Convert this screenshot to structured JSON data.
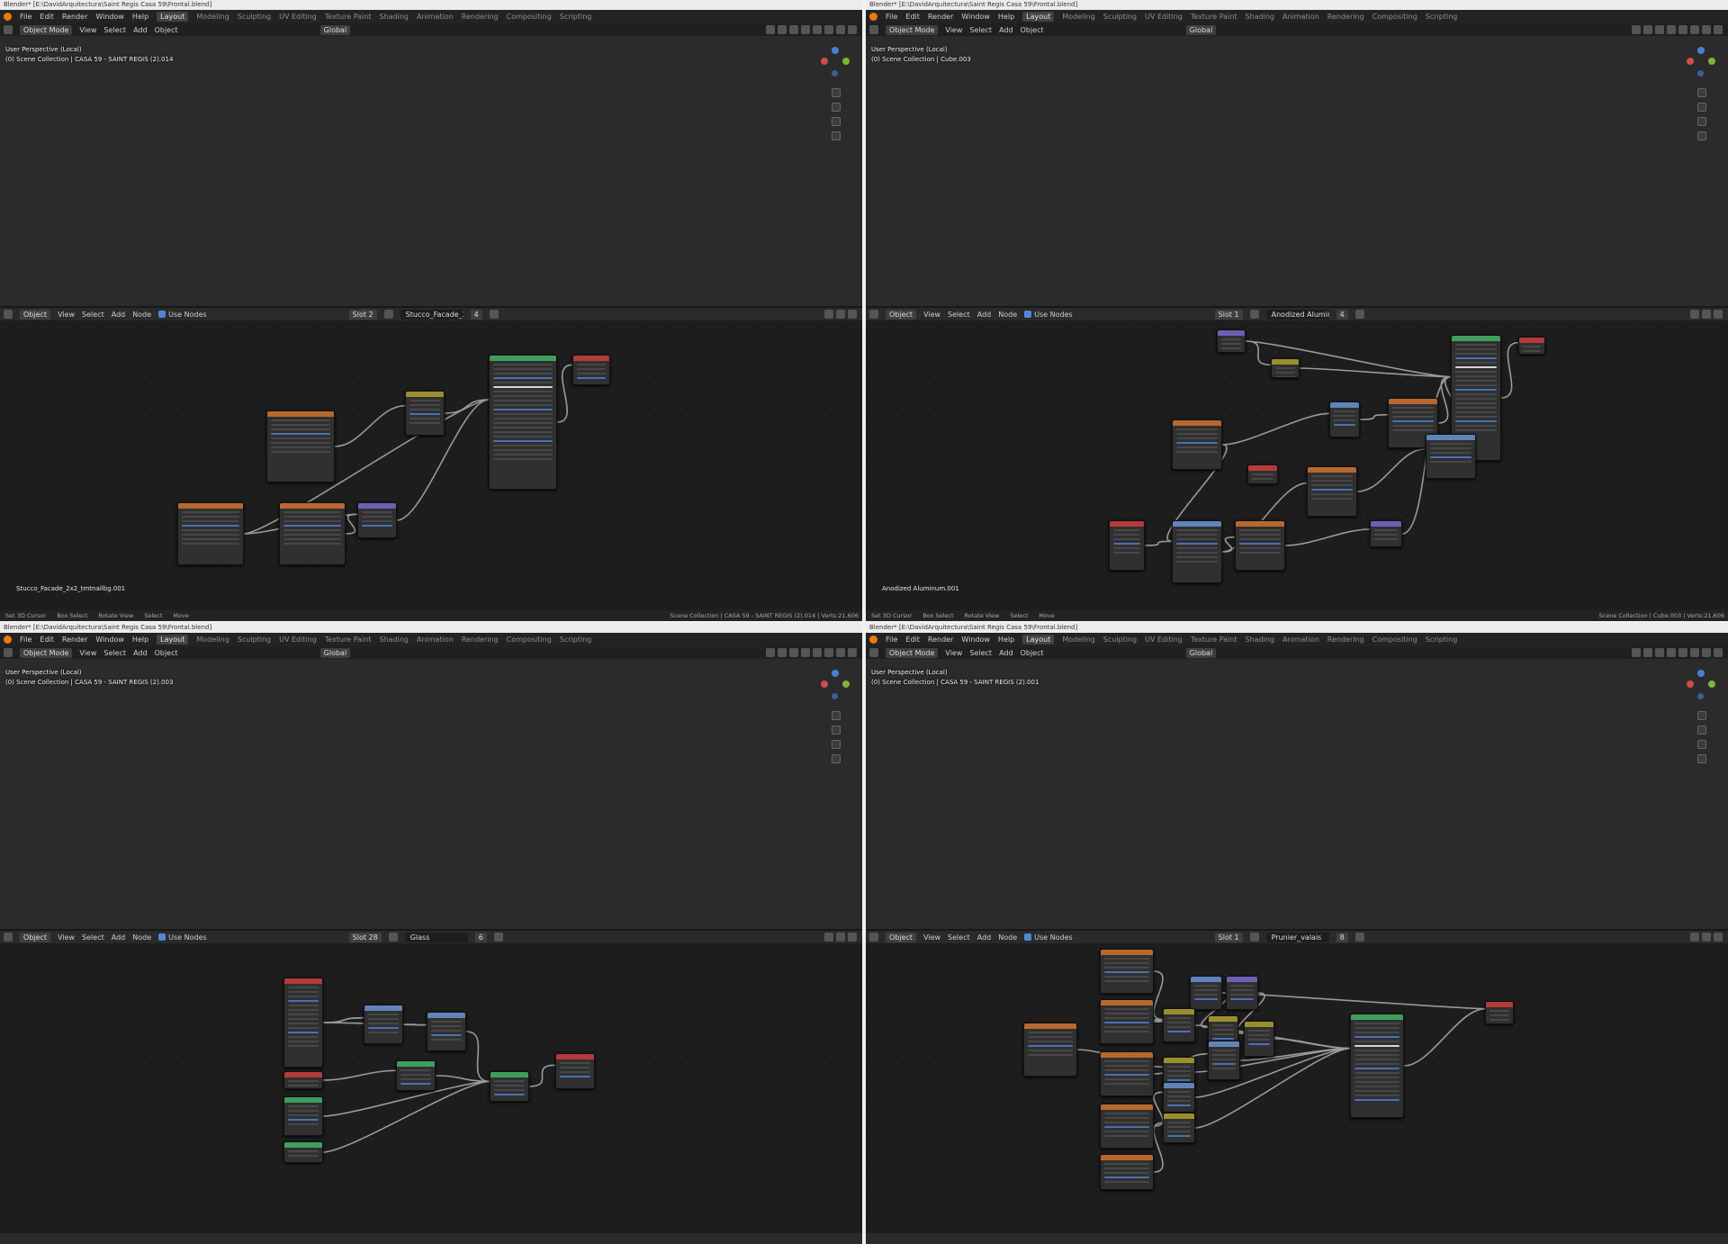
{
  "panes": [
    {
      "title": "Blender* [E:\\DavidArquitectura\\Saint Regis Casa 59\\Frontal.blend]",
      "menu": [
        "File",
        "Edit",
        "Render",
        "Window",
        "Help"
      ],
      "workspaces": [
        "Layout",
        "Modeling",
        "Sculpting",
        "UV Editing",
        "Texture Paint",
        "Shading",
        "Animation",
        "Rendering",
        "Compositing",
        "Scripting"
      ],
      "active_workspace": "Layout",
      "vp_header": {
        "mode": "Object Mode",
        "items": [
          "View",
          "Select",
          "Add",
          "Object"
        ],
        "orientation": "Global"
      },
      "vp_info": [
        "User Perspective (Local)",
        "(0) Scene Collection | CASA 59 - SAINT REGIS (2).014"
      ],
      "ne_header": {
        "type": "Object",
        "items": [
          "View",
          "Select",
          "Add",
          "Node"
        ],
        "use_nodes": "Use Nodes",
        "slot": "Slot 2",
        "material": "Stucco_Facade_2x...",
        "users": "4"
      },
      "material_label": "Stucco_Facade_2x2_tmtnailbg.001",
      "status": {
        "left": [
          "Set 3D Cursor",
          "Box Select",
          "Rotate View",
          "Select",
          "Move"
        ],
        "right": "Scene Collection | CASA 59 - SAINT REGIS (2).014 | Verts:21,606"
      }
    },
    {
      "title": "Blender* [E:\\DavidArquitectura\\Saint Regis Casa 59\\Frontal.blend]",
      "menu": [
        "File",
        "Edit",
        "Render",
        "Window",
        "Help"
      ],
      "workspaces": [
        "Layout",
        "Modeling",
        "Sculpting",
        "UV Editing",
        "Texture Paint",
        "Shading",
        "Animation",
        "Rendering",
        "Compositing",
        "Scripting"
      ],
      "active_workspace": "Layout",
      "vp_header": {
        "mode": "Object Mode",
        "items": [
          "View",
          "Select",
          "Add",
          "Object"
        ],
        "orientation": "Global"
      },
      "vp_info": [
        "User Perspective (Local)",
        "(0) Scene Collection | Cube.003"
      ],
      "ne_header": {
        "type": "Object",
        "items": [
          "View",
          "Select",
          "Add",
          "Node"
        ],
        "use_nodes": "Use Nodes",
        "slot": "Slot 1",
        "material": "Anodized Alumin...",
        "users": "4"
      },
      "material_label": "Anodized Aluminum.001",
      "status": {
        "left": [
          "Set 3D Cursor",
          "Box Select",
          "Rotate View",
          "Select",
          "Move"
        ],
        "right": "Scene Collection | Cube.003 | Verts:21,606"
      }
    },
    {
      "title": "Blender* [E:\\DavidArquitectura\\Saint Regis Casa 59\\Frontal.blend]",
      "menu": [
        "File",
        "Edit",
        "Render",
        "Window",
        "Help"
      ],
      "workspaces": [
        "Layout",
        "Modeling",
        "Sculpting",
        "UV Editing",
        "Texture Paint",
        "Shading",
        "Animation",
        "Rendering",
        "Compositing",
        "Scripting"
      ],
      "active_workspace": "Layout",
      "vp_header": {
        "mode": "Object Mode",
        "items": [
          "View",
          "Select",
          "Add",
          "Object"
        ],
        "orientation": "Global"
      },
      "vp_info": [
        "User Perspective (Local)",
        "(0) Scene Collection | CASA 59 - SAINT REGIS (2).003"
      ],
      "ne_header": {
        "type": "Object",
        "items": [
          "View",
          "Select",
          "Add",
          "Node"
        ],
        "use_nodes": "Use Nodes",
        "slot": "Slot 28",
        "material": "Glass",
        "users": "6"
      },
      "material_label": "",
      "status": {
        "left": [],
        "right": ""
      }
    },
    {
      "title": "Blender* [E:\\DavidArquitectura\\Saint Regis Casa 59\\Frontal.blend]",
      "menu": [
        "File",
        "Edit",
        "Render",
        "Window",
        "Help"
      ],
      "workspaces": [
        "Layout",
        "Modeling",
        "Sculpting",
        "UV Editing",
        "Texture Paint",
        "Shading",
        "Animation",
        "Rendering",
        "Compositing",
        "Scripting"
      ],
      "active_workspace": "Layout",
      "vp_header": {
        "mode": "Object Mode",
        "items": [
          "View",
          "Select",
          "Add",
          "Object"
        ],
        "orientation": "Global"
      },
      "vp_info": [
        "User Perspective (Local)",
        "(0) Scene Collection | CASA 59 - SAINT REGIS (2).001"
      ],
      "ne_header": {
        "type": "Object",
        "items": [
          "View",
          "Select",
          "Add",
          "Node"
        ],
        "use_nodes": "Use Nodes",
        "slot": "Slot 1",
        "material": "Prunier_valais",
        "users": "8"
      },
      "material_label": "",
      "status": {
        "left": [],
        "right": ""
      }
    }
  ],
  "icons": {
    "blender_logo": "blender-logo-icon",
    "zoom": "zoom-icon",
    "pan": "hand-pan-icon",
    "camera": "camera-icon",
    "grid": "grid-icon",
    "pin": "pin-icon"
  },
  "colors": {
    "node_shader": "#3f9e5c",
    "node_texture": "#b8682f",
    "node_output": "#b53a3a",
    "node_converter": "#5f84ba",
    "node_vector": "#6c5fb5",
    "node_color": "#9a8f2e",
    "link": "#9a9a9a",
    "accent": "#e87d0d"
  }
}
